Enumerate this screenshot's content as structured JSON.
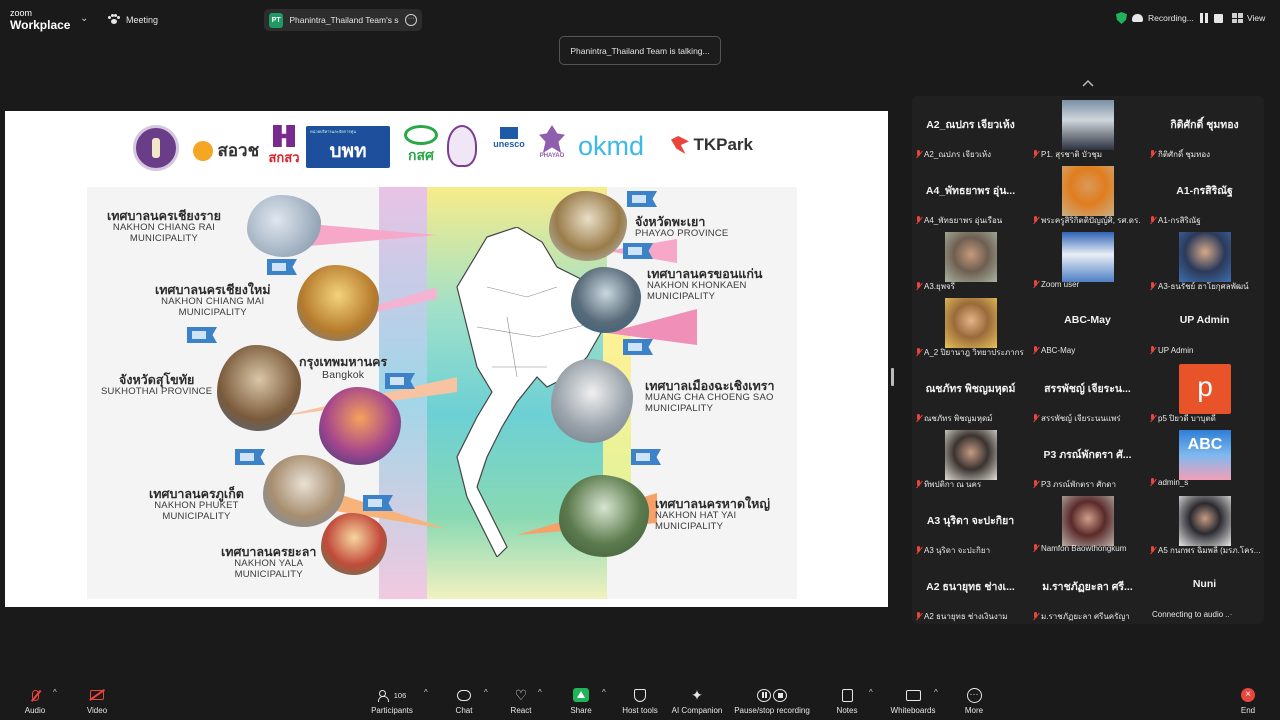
{
  "topbar": {
    "brand_small": "zoom",
    "brand_name": "Workplace",
    "meeting_label": "Meeting",
    "share_badge": "PT",
    "share_title": "Phanintra_Thailand Team's scree",
    "recording_label": "Recording...",
    "view_label": "View"
  },
  "talking_banner": "Phanintra_Thailand Team is talking...",
  "slide": {
    "logos": {
      "sawp": "สอวช",
      "sksw": "สกสว",
      "uwn": "บพท",
      "kss": "กสศ",
      "unesco": "unesco",
      "phayao": "PHAYAO",
      "okmd": "okmd",
      "tkpark": "TKPark"
    },
    "places": [
      {
        "th": "เทศบาลนครเชียงราย",
        "en1": "NAKHON CHIANG RAI",
        "en2": "MUNICIPALITY"
      },
      {
        "th": "เทศบาลนครเชียงใหม่",
        "en1": "NAKHON CHIANG MAI",
        "en2": "MUNICIPALITY"
      },
      {
        "th": "จังหวัดสุโขทัย",
        "en1": "SUKHOTHAI PROVINCE",
        "en2": ""
      },
      {
        "th": "กรุงเทพมหานคร",
        "en1": "Bangkok",
        "en2": ""
      },
      {
        "th": "เทศบาลนครภูเก็ต",
        "en1": "NAKHON PHUKET",
        "en2": "MUNICIPALITY"
      },
      {
        "th": "เทศบาลนครยะลา",
        "en1": "NAKHON YALA",
        "en2": "MUNICIPALITY"
      },
      {
        "th": "จังหวัดพะเยา",
        "en1": "PHAYAO PROVINCE",
        "en2": ""
      },
      {
        "th": "เทศบาลนครขอนแก่น",
        "en1": "NAKHON KHONKAEN",
        "en2": "MUNICIPALITY"
      },
      {
        "th": "เทศบาลเมืองฉะเชิงเทรา",
        "en1": "MUANG CHA CHOENG SAO",
        "en2": "MUNICIPALITY"
      },
      {
        "th": "เทศบาลนครหาดใหญ่",
        "en1": "NAKHON HAT YAI",
        "en2": "MUNICIPALITY"
      }
    ]
  },
  "gallery": {
    "tiles": [
      {
        "big": "A2_ณปภร เจียวเห้ง",
        "label": "A2_ณปภร เจียวเห้ง"
      },
      {
        "big": "",
        "label": "P1. สุรชาติ บัวชุม"
      },
      {
        "big": "กิติศักดิ์ ชุมทอง",
        "label": "กิติศักดิ์ ชุมทอง"
      },
      {
        "big": "A4_พัทธยาพร อุ่น...",
        "label": "A4_พัทธยาพร อุ่นเรือน"
      },
      {
        "big": "",
        "label": "พระครูสิริกิตติปัญญ์ศิ, รศ.ดร."
      },
      {
        "big": "A1-กรสิริณัฐ",
        "label": "A1-กรสิริณัฐ"
      },
      {
        "big": "",
        "label": "A3.ยุพจรี"
      },
      {
        "big": "",
        "label": "Zoom user"
      },
      {
        "big": "",
        "label": "A3-ธนรัชย์ ฮาโยกุศลพัฒน์"
      },
      {
        "big": "",
        "label": "A_2 ปิยานาฎ วิทยาประภากร"
      },
      {
        "big": "ABC-May",
        "label": "ABC-May"
      },
      {
        "big": "UP Admin",
        "label": "UP Admin"
      },
      {
        "big": "ณชภัทร พิชญมหุดม์",
        "label": "ณชภัทร พิชญมหุดม์"
      },
      {
        "big": "สรรพัชญ์ เจียระน...",
        "label": "สรรพัชญ์ เจียระนนแพร่"
      },
      {
        "big": "",
        "label": "p5 ปิยวดี บาบุตดี"
      },
      {
        "big": "",
        "label": "ทิพปติกา ณ นคร"
      },
      {
        "big": "P3 ภรณ์พักตรา ศั...",
        "label": "P3 ภรณ์พักตรา ศักดา"
      },
      {
        "big": "",
        "label": "admin_s"
      },
      {
        "big": "A3 นุริดา จะปะกิยา",
        "label": "A3 นุริดา จะปะกิยา"
      },
      {
        "big": "",
        "label": "Namfon Baowthongkum"
      },
      {
        "big": "",
        "label": "A5 กนกพร ฉิมพลี (มรภ.โคร..."
      },
      {
        "big": "A2 ธนายุทธ ช่างเ...",
        "label": "A2 ธนายุทธ ช่างเงินงาม"
      },
      {
        "big": "ม.ราชภัฏยะลา ศรี...",
        "label": "ม.ราชภัฏยะลา ศรีนครัญา"
      },
      {
        "big": "Nuni",
        "label": "Connecting to audio"
      }
    ],
    "avatar_p": "p",
    "avatar_abc": "ABC"
  },
  "toolbar": {
    "audio": "Audio",
    "video": "Video",
    "participants": "Participants",
    "participant_count": "106",
    "chat": "Chat",
    "react": "React",
    "share": "Share",
    "host_tools": "Host tools",
    "ai_companion": "AI Companion",
    "pause_recording": "Pause/stop recording",
    "notes": "Notes",
    "whiteboards": "Whiteboards",
    "more": "More",
    "end": "End"
  },
  "colors": {
    "accent_green": "#1fb35a",
    "mute_red": "#e8453c",
    "background": "#1a1a1a"
  }
}
